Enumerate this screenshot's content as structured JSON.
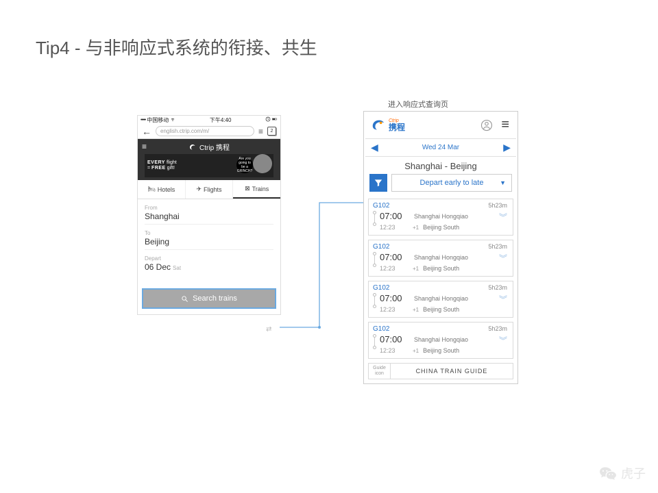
{
  "slide": {
    "title": "Tip4 - 与非响应式系统的衔接、共生"
  },
  "left": {
    "status": {
      "carrier": "中国移动",
      "time": "下午4:40",
      "tabs_count": "2",
      "signal": "•••••",
      "wifi": true
    },
    "url": "english.ctrip.com/m/",
    "brand_top": "Ctrip 携程",
    "banner_line1_em": "EVERY",
    "banner_line1": "flight",
    "banner_line2_eq": "=",
    "banner_line2_em": "FREE",
    "banner_line2": "gift!",
    "banner_bubble": "Are you going to be a GRINCH?",
    "tabs": [
      "Hotels",
      "Flights",
      "Trains"
    ],
    "from_label": "From",
    "from_value": "Shanghai",
    "to_label": "To",
    "to_value": "Beijing",
    "depart_label": "Depart",
    "depart_value": "06 Dec",
    "depart_day": "Sat",
    "search_btn": "Search trains"
  },
  "right": {
    "caption": "进入响应式查询页",
    "brand_en": "Ctrip",
    "brand_cn": "携程",
    "date": "Wed 24 Mar",
    "route": "Shanghai - Beijing",
    "sort_label": "Depart early to late",
    "results": [
      {
        "train": "G102",
        "depart_time": "07:00",
        "arrive_time": "12:23",
        "day": "+1",
        "from": "Shanghai Hongqiao",
        "to": "Beijing South",
        "dur": "5h23m"
      },
      {
        "train": "G102",
        "depart_time": "07:00",
        "arrive_time": "12:23",
        "day": "+1",
        "from": "Shanghai Hongqiao",
        "to": "Beijing South",
        "dur": "5h23m"
      },
      {
        "train": "G102",
        "depart_time": "07:00",
        "arrive_time": "12:23",
        "day": "+1",
        "from": "Shanghai Hongqiao",
        "to": "Beijing South",
        "dur": "5h23m"
      },
      {
        "train": "G102",
        "depart_time": "07:00",
        "arrive_time": "12:23",
        "day": "+1",
        "from": "Shanghai Hongqiao",
        "to": "Beijing South",
        "dur": "5h23m"
      }
    ],
    "guide_icon": "Guide icon",
    "guide_text": "CHINA TRAIN GUIDE"
  },
  "watermark": "虎子"
}
